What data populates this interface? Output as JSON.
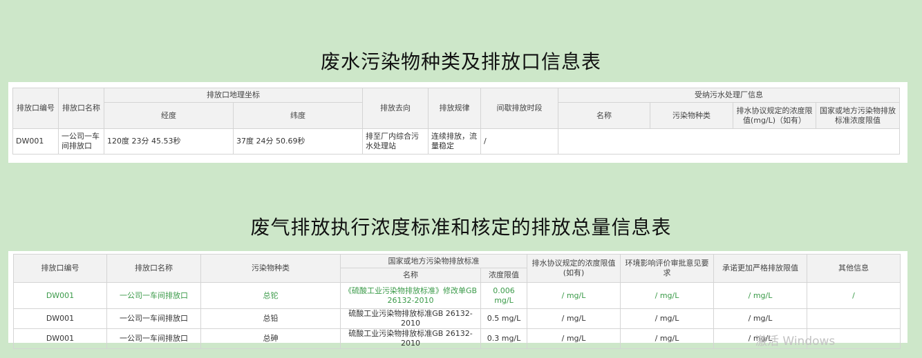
{
  "title1": "废水污染物种类及排放口信息表",
  "title2": "废气排放执行浓度标准和核定的排放总量信息表",
  "table1": {
    "headers": {
      "outlet_no": "排放口编号",
      "outlet_name": "排放口名称",
      "coords": "排放口地理坐标",
      "longitude": "经度",
      "latitude": "纬度",
      "destination": "排放去向",
      "pattern": "排放规律",
      "intermittent": "间歇排放时段",
      "receiving": "受纳污水处理厂信息",
      "name": "名称",
      "pollutant": "污染物种类",
      "agreement_limit": "排水协议规定的浓度限值(mg/L)（如有）",
      "national_limit": "国家或地方污染物排放标准浓度限值"
    },
    "row": {
      "outlet_no": "DW001",
      "outlet_name": "一公司一车间排放口",
      "longitude": "120度 23分 45.53秒",
      "latitude": "37度 24分 50.69秒",
      "destination": "排至厂内综合污水处理站",
      "pattern": "连续排放，流量稳定",
      "intermittent": "/"
    }
  },
  "table2": {
    "headers": {
      "outlet_no": "排放口编号",
      "outlet_name": "排放口名称",
      "pollutant": "污染物种类",
      "standard": "国家或地方污染物排放标准",
      "std_name": "名称",
      "std_limit": "浓度限值",
      "agreement": "排水协议规定的浓度限值(如有)",
      "eia": "环境影响评价审批意见要求",
      "commitment": "承诺更加严格排放限值",
      "other": "其他信息"
    },
    "rows": [
      {
        "outlet_no": "DW001",
        "outlet_name": "一公司一车间排放口",
        "pollutant": "总铊",
        "std_name": "《硫酸工业污染物排放标准》修改单GB 26132-2010",
        "std_limit": "0.006 mg/L",
        "agreement": "/ mg/L",
        "eia": "/ mg/L",
        "commitment": "/ mg/L",
        "other": "/"
      },
      {
        "outlet_no": "DW001",
        "outlet_name": "一公司一车间排放口",
        "pollutant": "总铅",
        "std_name": "硫酸工业污染物排放标准GB 26132-2010",
        "std_limit": "0.5 mg/L",
        "agreement": "/ mg/L",
        "eia": "/ mg/L",
        "commitment": "/ mg/L",
        "other": ""
      },
      {
        "outlet_no": "DW001",
        "outlet_name": "一公司一车间排放口",
        "pollutant": "总砷",
        "std_name": "硫酸工业污染物排放标准GB 26132-2010",
        "std_limit": "0.3 mg/L",
        "agreement": "/ mg/L",
        "eia": "/ mg/L",
        "commitment": "/ mg/L",
        "other": ""
      }
    ]
  },
  "watermark": "激活 Windows",
  "colors": {
    "background": "#cde7c9",
    "highlight_text": "#3a9a48",
    "header_bg": "#f2f2f2",
    "border": "#d4d4d4"
  }
}
